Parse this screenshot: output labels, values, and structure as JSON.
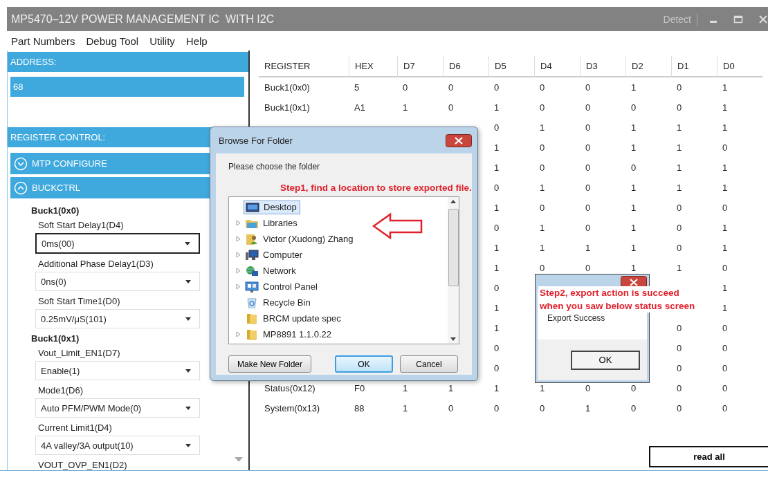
{
  "window": {
    "title": "MP5470–12V POWER MANAGEMENT IC  WITH I2C",
    "detect": "Detect"
  },
  "menu": [
    "Part Numbers",
    "Debug Tool",
    "Utility",
    "Help"
  ],
  "address": {
    "header": "ADDRESS:",
    "value": "68"
  },
  "register_control": {
    "header": "REGISTER CONTROL:",
    "sections": [
      {
        "title": "MTP CONFIGURE",
        "expanded": false
      },
      {
        "title": "BUCKCTRL",
        "expanded": true,
        "groups": [
          {
            "title": "Buck1(0x0)",
            "fields": [
              {
                "label": "Soft Start Delay1(D4)",
                "value": "0ms(00)",
                "focused": true
              },
              {
                "label": "Additional Phase Delay1(D3)",
                "value": "0ns(0)",
                "focused": false
              },
              {
                "label": "Soft Start Time1(D0)",
                "value": "0.25mV/μS(101)",
                "focused": false
              }
            ]
          },
          {
            "title": "Buck1(0x1)",
            "fields": [
              {
                "label": "Vout_Limit_EN1(D7)",
                "value": "Enable(1)",
                "focused": false
              },
              {
                "label": "Mode1(D6)",
                "value": "Auto PFM/PWM Mode(0)",
                "focused": false
              },
              {
                "label": "Current Limit1(D4)",
                "value": "4A valley/3A output(10)",
                "focused": false
              },
              {
                "label": "VOUT_OVP_EN1(D2)"
              }
            ]
          }
        ]
      }
    ]
  },
  "table": {
    "columns": [
      "REGISTER",
      "HEX",
      "D7",
      "D6",
      "D5",
      "D4",
      "D3",
      "D2",
      "D1",
      "D0"
    ],
    "rows": [
      {
        "cells": [
          "Buck1(0x0)",
          "5",
          "0",
          "0",
          "0",
          "0",
          "0",
          "1",
          "0",
          "1"
        ]
      },
      {
        "cells": [
          "Buck1(0x1)",
          "A1",
          "1",
          "0",
          "1",
          "0",
          "0",
          "0",
          "0",
          "1"
        ]
      },
      {
        "cells": [
          null,
          null,
          null,
          null,
          "0",
          "1",
          "0",
          "1",
          "1",
          "1"
        ]
      },
      {
        "cells": [
          null,
          null,
          null,
          null,
          "1",
          "0",
          "0",
          "1",
          "1",
          "0"
        ]
      },
      {
        "cells": [
          null,
          null,
          null,
          null,
          "1",
          "0",
          "0",
          "0",
          "1",
          "1"
        ]
      },
      {
        "cells": [
          null,
          null,
          null,
          null,
          "0",
          "1",
          "0",
          "1",
          "1",
          "1"
        ]
      },
      {
        "cells": [
          null,
          null,
          null,
          null,
          "1",
          "0",
          "0",
          "1",
          "0",
          "0"
        ]
      },
      {
        "cells": [
          null,
          null,
          null,
          null,
          "0",
          "1",
          "0",
          "1",
          "0",
          "1"
        ]
      },
      {
        "cells": [
          null,
          null,
          null,
          null,
          "1",
          "1",
          "1",
          "1",
          "0",
          "1"
        ]
      },
      {
        "cells": [
          null,
          null,
          null,
          null,
          "1",
          "0",
          "0",
          "1",
          "1",
          "0"
        ]
      },
      {
        "cells": [
          null,
          null,
          null,
          null,
          "0",
          null,
          null,
          null,
          null,
          "1"
        ]
      },
      {
        "cells": [
          null,
          null,
          null,
          null,
          "1",
          null,
          null,
          null,
          null,
          "1"
        ]
      },
      {
        "cells": [
          null,
          null,
          null,
          null,
          "1",
          null,
          null,
          null,
          "0",
          "0"
        ]
      },
      {
        "cells": [
          null,
          null,
          null,
          null,
          "0",
          null,
          null,
          null,
          "0",
          "0"
        ]
      },
      {
        "cells": [
          null,
          null,
          null,
          null,
          "0",
          null,
          null,
          null,
          "0",
          "0"
        ]
      },
      {
        "cells": [
          "Status(0x12)",
          "F0",
          "1",
          "1",
          "1",
          "1",
          "0",
          "0",
          "0",
          "0"
        ]
      },
      {
        "cells": [
          "System(0x13)",
          "88",
          "1",
          "0",
          "0",
          "0",
          "1",
          "0",
          "0",
          "0"
        ]
      }
    ]
  },
  "read_all": "read all",
  "browse_dialog": {
    "title": "Browse For Folder",
    "prompt": "Please choose the folder",
    "items": [
      {
        "label": "Desktop",
        "kind": "desktop",
        "expandable": false,
        "selected": true
      },
      {
        "label": "Libraries",
        "kind": "library",
        "expandable": true,
        "selected": false
      },
      {
        "label": "Victor (Xudong) Zhang",
        "kind": "user",
        "expandable": true,
        "selected": false
      },
      {
        "label": "Computer",
        "kind": "computer",
        "expandable": true,
        "selected": false
      },
      {
        "label": "Network",
        "kind": "network",
        "expandable": true,
        "selected": false
      },
      {
        "label": "Control Panel",
        "kind": "control-panel",
        "expandable": true,
        "selected": false
      },
      {
        "label": "Recycle Bin",
        "kind": "recycle-bin",
        "expandable": false,
        "selected": false
      },
      {
        "label": "BRCM update spec",
        "kind": "folder",
        "expandable": false,
        "selected": false
      },
      {
        "label": "MP8891 1.1.0.22",
        "kind": "folder",
        "expandable": true,
        "selected": false
      }
    ],
    "buttons": [
      {
        "label": "Make New Folder",
        "default": false
      },
      {
        "label": "OK",
        "default": true
      },
      {
        "label": "Cancel",
        "default": false
      }
    ]
  },
  "export_dialog": {
    "message": "Export Success",
    "button": "OK"
  },
  "annotations": [
    "Step1, find a location to store exported file.",
    "Step2, export action is succeed\nwhen you saw below status screen"
  ]
}
